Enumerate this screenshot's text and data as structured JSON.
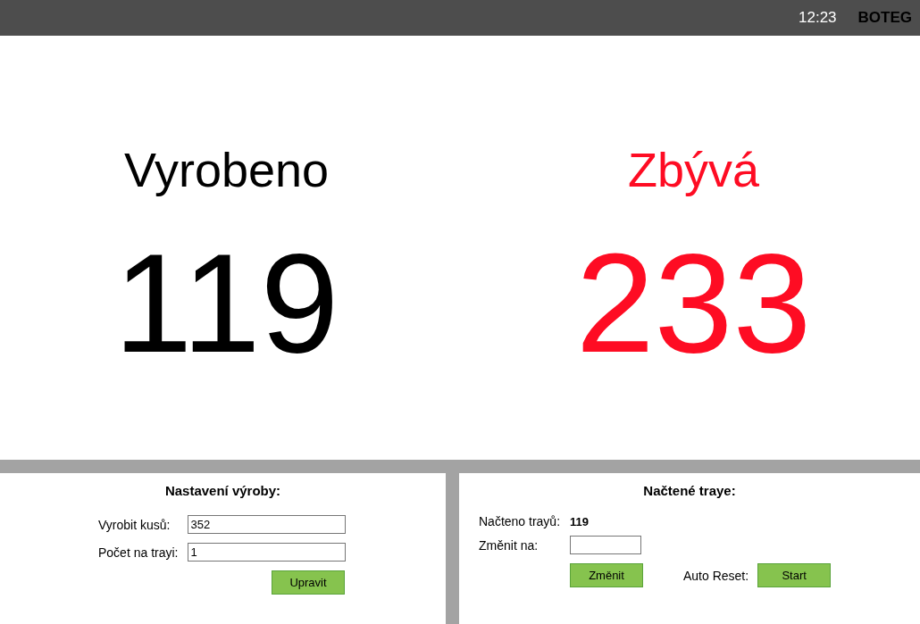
{
  "top_bar": {
    "time": "12:23",
    "brand": "BOTEG"
  },
  "counters": [
    {
      "label": "Vyrobeno",
      "value": "119",
      "kind": "done"
    },
    {
      "label": "Zbývá",
      "value": "233",
      "kind": "remaining"
    }
  ],
  "production_settings": {
    "title": "Nastavení výroby:",
    "fields": [
      {
        "label": "Vyrobit kusů:",
        "value": "352"
      },
      {
        "label": "Počet na trayi:",
        "value": "1"
      }
    ],
    "button": "Upravit"
  },
  "loaded_trays": {
    "title": "Načtené traye:",
    "count_label": "Načteno trayů:",
    "count": "119",
    "change_label": "Změnit na:",
    "change_button": "Změnit",
    "auto_reset_label": "Auto Reset:",
    "auto_reset_button": "Start"
  }
}
